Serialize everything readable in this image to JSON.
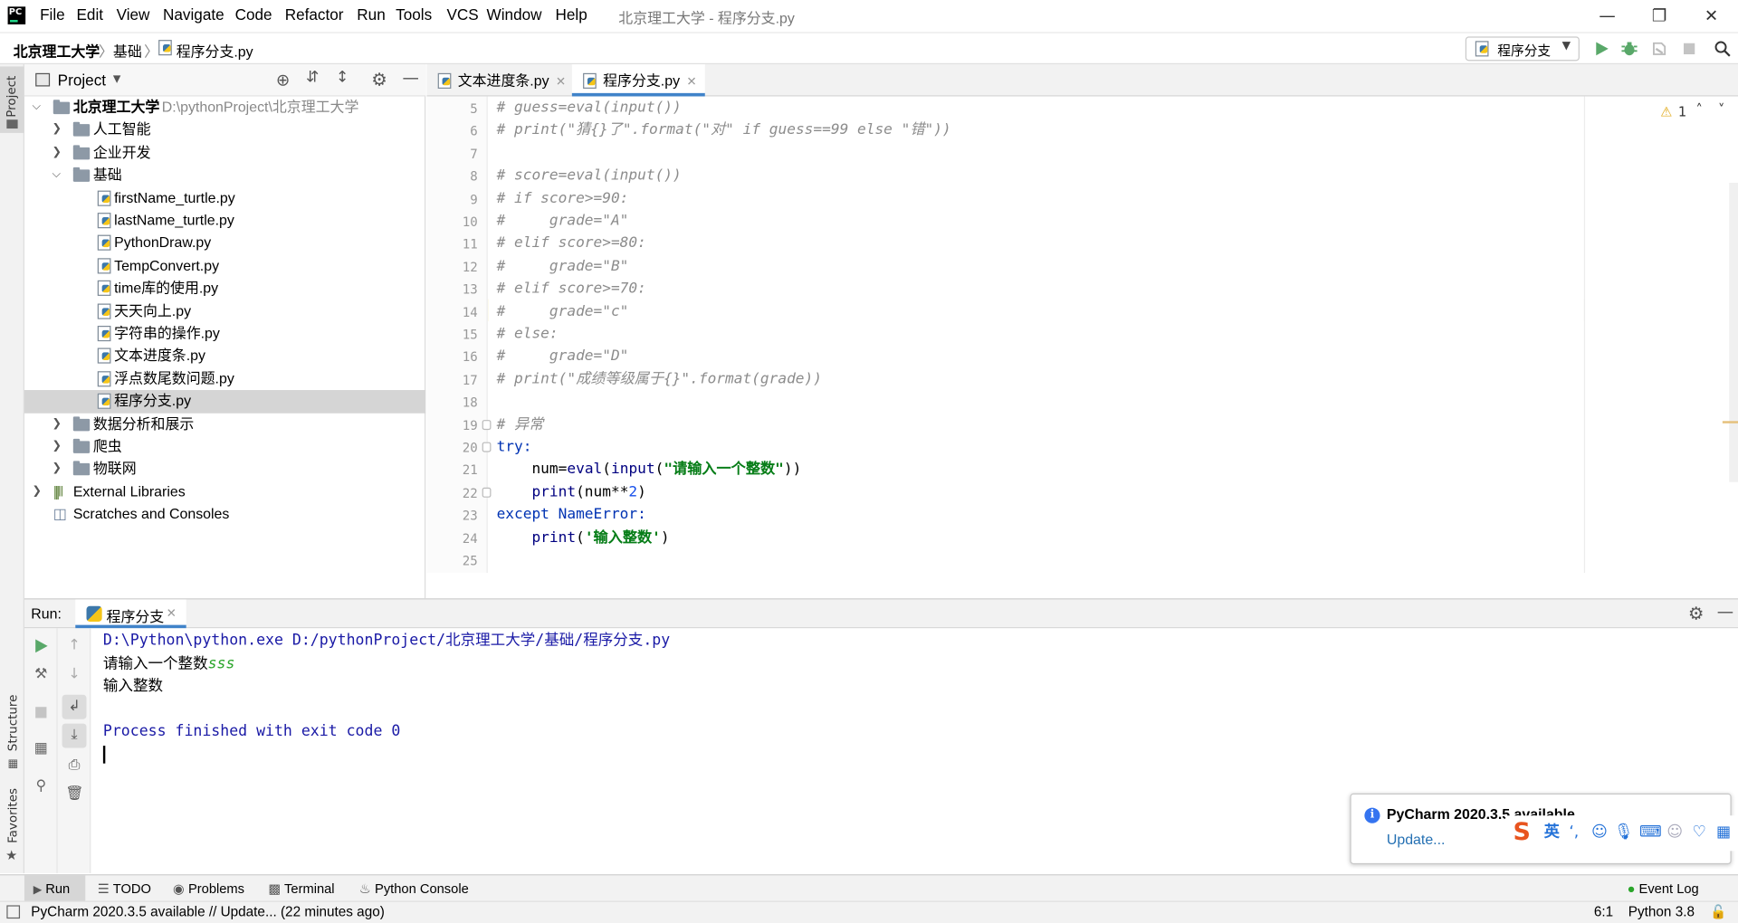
{
  "window": {
    "title": "北京理工大学 - 程序分支.py",
    "menu": [
      "File",
      "Edit",
      "View",
      "Navigate",
      "Code",
      "Refactor",
      "Run",
      "Tools",
      "VCS",
      "Window",
      "Help"
    ]
  },
  "breadcrumb": {
    "project": "北京理工大学",
    "folder": "基础",
    "file": "程序分支.py"
  },
  "toolbar": {
    "run_config": "程序分支"
  },
  "left_stripe": {
    "project": "Project",
    "structure": "Structure",
    "favorites": "Favorites"
  },
  "project_panel": {
    "header": "Project",
    "tree": [
      {
        "label": "北京理工大学",
        "path": "D:\\pythonProject\\北京理工大学",
        "kind": "root"
      },
      {
        "label": "人工智能",
        "kind": "folder"
      },
      {
        "label": "企业开发",
        "kind": "folder"
      },
      {
        "label": "基础",
        "kind": "folder-open"
      },
      {
        "label": "firstName_turtle.py",
        "kind": "file"
      },
      {
        "label": "lastName_turtle.py",
        "kind": "file"
      },
      {
        "label": "PythonDraw.py",
        "kind": "file"
      },
      {
        "label": "TempConvert.py",
        "kind": "file"
      },
      {
        "label": "time库的使用.py",
        "kind": "file"
      },
      {
        "label": "天天向上.py",
        "kind": "file"
      },
      {
        "label": "字符串的操作.py",
        "kind": "file"
      },
      {
        "label": "文本进度条.py",
        "kind": "file"
      },
      {
        "label": "浮点数尾数问题.py",
        "kind": "file"
      },
      {
        "label": "程序分支.py",
        "kind": "file-selected"
      },
      {
        "label": "数据分析和展示",
        "kind": "folder"
      },
      {
        "label": "爬虫",
        "kind": "folder"
      },
      {
        "label": "物联网",
        "kind": "folder"
      },
      {
        "label": "External Libraries",
        "kind": "libs"
      },
      {
        "label": "Scratches and Consoles",
        "kind": "scratch"
      }
    ]
  },
  "editor": {
    "tabs": [
      {
        "label": "文本进度条.py",
        "active": false
      },
      {
        "label": "程序分支.py",
        "active": true
      }
    ],
    "warnings": "1",
    "lines": [
      {
        "n": "5",
        "t": "# guess=eval(input())",
        "c": "cm"
      },
      {
        "n": "6",
        "t": "# print(\"猜{}了\".format(\"对\" if guess==99 else \"错\"))",
        "c": "cm"
      },
      {
        "n": "7",
        "t": "",
        "c": ""
      },
      {
        "n": "8",
        "t": "# score=eval(input())",
        "c": "cm"
      },
      {
        "n": "9",
        "t": "# if score>=90:",
        "c": "cm"
      },
      {
        "n": "10",
        "t": "#     grade=\"A\"",
        "c": "cm"
      },
      {
        "n": "11",
        "t": "# elif score>=80:",
        "c": "cm"
      },
      {
        "n": "12",
        "t": "#     grade=\"B\"",
        "c": "cm"
      },
      {
        "n": "13",
        "t": "# elif score>=70:",
        "c": "cm"
      },
      {
        "n": "14",
        "t": "#     grade=\"c\"",
        "c": "cm"
      },
      {
        "n": "15",
        "t": "# else:",
        "c": "cm"
      },
      {
        "n": "16",
        "t": "#     grade=\"D\"",
        "c": "cm"
      },
      {
        "n": "17",
        "t": "# print(\"成绩等级属于{}\".format(grade))",
        "c": "cm"
      },
      {
        "n": "18",
        "t": "",
        "c": ""
      },
      {
        "n": "19",
        "t": "# 异常",
        "c": "cm"
      },
      {
        "n": "20",
        "t": "try:",
        "c": "kw"
      },
      {
        "n": "21",
        "t": "    num=eval(input(\"请输入一个整数\"))",
        "c": "mix1"
      },
      {
        "n": "22",
        "t": "    print(num**2)",
        "c": "mix2"
      },
      {
        "n": "23",
        "t": "except NameError:",
        "c": "kw"
      },
      {
        "n": "24",
        "t": "    print('输入整数')",
        "c": "mix3"
      },
      {
        "n": "25",
        "t": "",
        "c": ""
      }
    ],
    "code_parts": {
      "l21a": "    num=",
      "l21b": "eval",
      "l21c": "(",
      "l21d": "input",
      "l21e": "(",
      "l21f": "\"请输入一个整数\"",
      "l21g": "))",
      "l22a": "    print",
      "l22b": "(num**",
      "l22c": "2",
      "l22d": ")",
      "l24a": "    print",
      "l24b": "(",
      "l24c": "'输入整数'",
      "l24d": ")"
    }
  },
  "run_panel": {
    "label": "Run:",
    "tab": "程序分支",
    "output": {
      "cmd": "D:\\Python\\python.exe D:/pythonProject/北京理工大学/基础/程序分支.py",
      "prompt": "请输入一个整数",
      "user_input": "sss",
      "result": "输入整数",
      "exit": "Process finished with exit code 0"
    }
  },
  "tool_tabs": {
    "run": "Run",
    "todo": "TODO",
    "problems": "Problems",
    "terminal": "Terminal",
    "python_console": "Python Console",
    "event_log": "Event Log"
  },
  "status": {
    "message": "PyCharm 2020.3.5 available // Update... (22 minutes ago)",
    "position": "6:1",
    "interpreter": "Python 3.8"
  },
  "notification": {
    "title": "PyCharm 2020.3.5 available",
    "link": "Update..."
  },
  "ime": {
    "lang": "英"
  }
}
